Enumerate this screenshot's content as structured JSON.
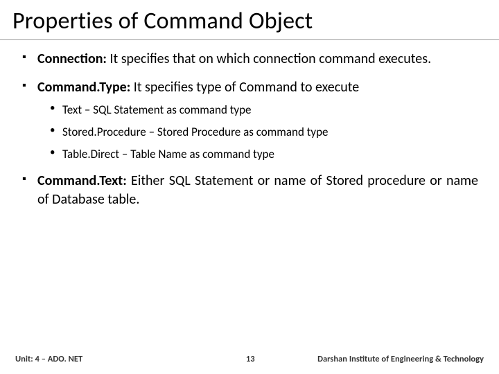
{
  "title": "Properties of Command Object",
  "items": [
    {
      "term": "Connection:",
      "desc": " It specifies that on which connection command executes."
    },
    {
      "term": "Command.Type:",
      "desc": " It specifies type of Command to execute",
      "sub": [
        "Text – SQL Statement as command type",
        "Stored.Procedure – Stored Procedure as command type",
        "Table.Direct – Table Name as command type"
      ]
    },
    {
      "term": "Command.Text:",
      "desc": " Either SQL Statement or name of Stored procedure or name of Database table."
    }
  ],
  "footer": {
    "left": "Unit: 4 – ADO. NET",
    "center": "13",
    "right": "Darshan Institute of Engineering & Technology"
  }
}
